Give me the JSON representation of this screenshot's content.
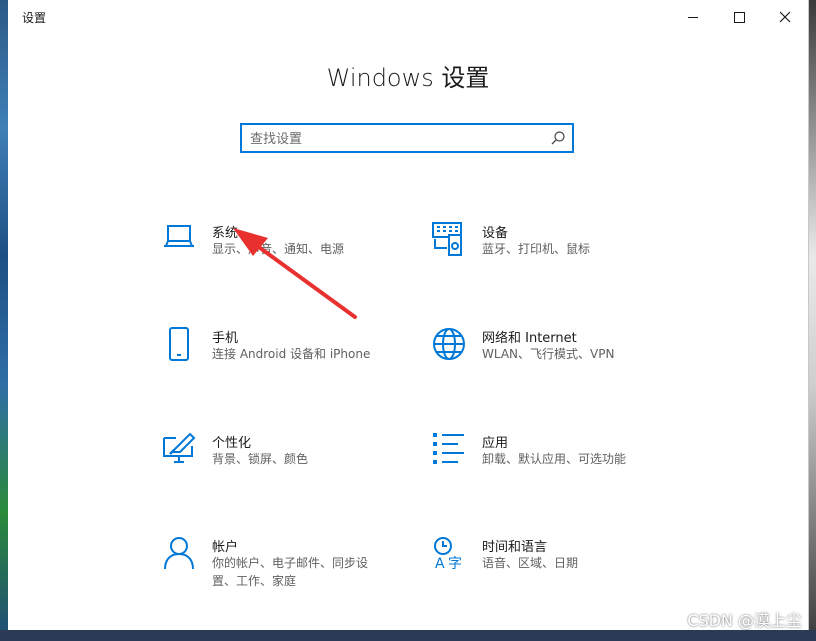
{
  "window": {
    "title": "设置",
    "heading": "Windows 设置",
    "controls": {
      "minimize": "minimize",
      "maximize": "maximize",
      "close": "close"
    }
  },
  "search": {
    "placeholder": "查找设置",
    "icon": "search-icon"
  },
  "tiles": [
    {
      "name": "系统",
      "desc": "显示、声音、通知、电源",
      "icon": "laptop-icon"
    },
    {
      "name": "设备",
      "desc": "蓝牙、打印机、鼠标",
      "icon": "keyboard-device-icon"
    },
    {
      "name": "手机",
      "desc": "连接 Android 设备和 iPhone",
      "icon": "phone-icon"
    },
    {
      "name": "网络和 Internet",
      "desc": "WLAN、飞行模式、VPN",
      "icon": "globe-icon"
    },
    {
      "name": "个性化",
      "desc": "背景、锁屏、颜色",
      "icon": "paint-monitor-icon"
    },
    {
      "name": "应用",
      "desc": "卸载、默认应用、可选功能",
      "icon": "apps-list-icon"
    },
    {
      "name": "帐户",
      "desc": "你的帐户、电子邮件、同步设置、工作、家庭",
      "icon": "person-icon"
    },
    {
      "name": "时间和语言",
      "desc": "语音、区域、日期",
      "icon": "language-icon"
    }
  ],
  "watermark": "CSDN @漠上尘",
  "colors": {
    "accent": "#0078d7",
    "annotation_arrow": "#e8312f"
  }
}
